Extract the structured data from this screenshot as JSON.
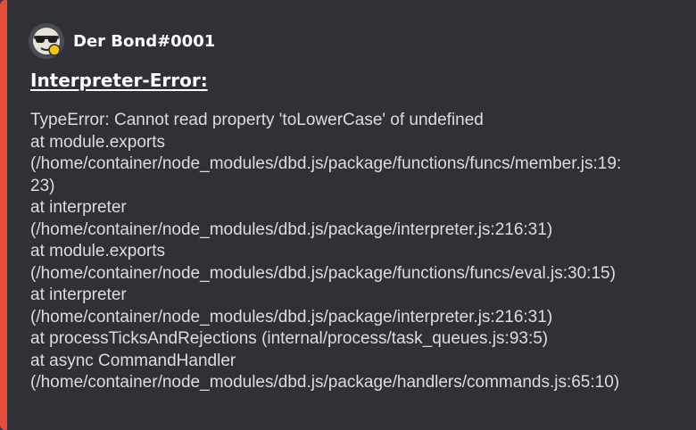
{
  "embed": {
    "accent_color": "#e74c3c",
    "author": {
      "name": "Der Bond#0001",
      "avatar_icon": "sunglasses-face-avatar-icon"
    },
    "title": "Interpreter-Error:",
    "description_lines": [
      "TypeError: Cannot read property 'toLowerCase' of undefined",
      "at module.exports",
      "(/home/container/node_modules/dbd.js/package/functions/funcs/member.js:19:",
      "23)",
      "at interpreter",
      "(/home/container/node_modules/dbd.js/package/interpreter.js:216:31)",
      "at module.exports",
      "(/home/container/node_modules/dbd.js/package/functions/funcs/eval.js:30:15)",
      "at interpreter",
      "(/home/container/node_modules/dbd.js/package/interpreter.js:216:31)",
      "at processTicksAndRejections (internal/process/task_queues.js:93:5)",
      "at async CommandHandler",
      "(/home/container/node_modules/dbd.js/package/handlers/commands.js:65:10)"
    ]
  }
}
